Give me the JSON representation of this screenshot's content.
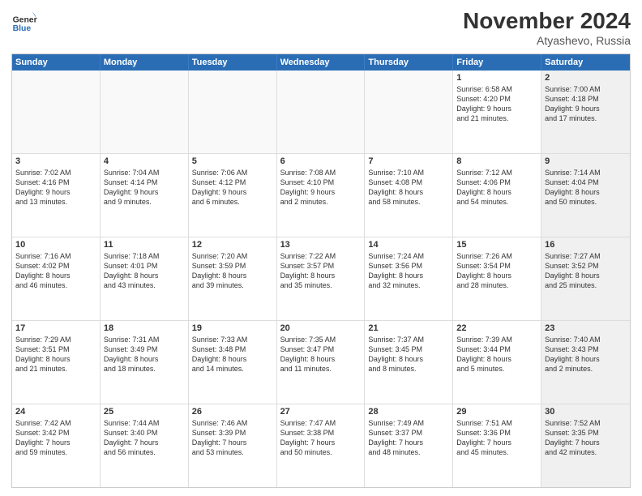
{
  "header": {
    "title": "November 2024",
    "location": "Atyashevo, Russia"
  },
  "days": [
    "Sunday",
    "Monday",
    "Tuesday",
    "Wednesday",
    "Thursday",
    "Friday",
    "Saturday"
  ],
  "rows": [
    [
      {
        "day": "",
        "info": "",
        "empty": true
      },
      {
        "day": "",
        "info": "",
        "empty": true
      },
      {
        "day": "",
        "info": "",
        "empty": true
      },
      {
        "day": "",
        "info": "",
        "empty": true
      },
      {
        "day": "",
        "info": "",
        "empty": true
      },
      {
        "day": "1",
        "info": "Sunrise: 6:58 AM\nSunset: 4:20 PM\nDaylight: 9 hours\nand 21 minutes.",
        "empty": false
      },
      {
        "day": "2",
        "info": "Sunrise: 7:00 AM\nSunset: 4:18 PM\nDaylight: 9 hours\nand 17 minutes.",
        "empty": false,
        "shaded": true
      }
    ],
    [
      {
        "day": "3",
        "info": "Sunrise: 7:02 AM\nSunset: 4:16 PM\nDaylight: 9 hours\nand 13 minutes.",
        "empty": false
      },
      {
        "day": "4",
        "info": "Sunrise: 7:04 AM\nSunset: 4:14 PM\nDaylight: 9 hours\nand 9 minutes.",
        "empty": false
      },
      {
        "day": "5",
        "info": "Sunrise: 7:06 AM\nSunset: 4:12 PM\nDaylight: 9 hours\nand 6 minutes.",
        "empty": false
      },
      {
        "day": "6",
        "info": "Sunrise: 7:08 AM\nSunset: 4:10 PM\nDaylight: 9 hours\nand 2 minutes.",
        "empty": false
      },
      {
        "day": "7",
        "info": "Sunrise: 7:10 AM\nSunset: 4:08 PM\nDaylight: 8 hours\nand 58 minutes.",
        "empty": false
      },
      {
        "day": "8",
        "info": "Sunrise: 7:12 AM\nSunset: 4:06 PM\nDaylight: 8 hours\nand 54 minutes.",
        "empty": false
      },
      {
        "day": "9",
        "info": "Sunrise: 7:14 AM\nSunset: 4:04 PM\nDaylight: 8 hours\nand 50 minutes.",
        "empty": false,
        "shaded": true
      }
    ],
    [
      {
        "day": "10",
        "info": "Sunrise: 7:16 AM\nSunset: 4:02 PM\nDaylight: 8 hours\nand 46 minutes.",
        "empty": false
      },
      {
        "day": "11",
        "info": "Sunrise: 7:18 AM\nSunset: 4:01 PM\nDaylight: 8 hours\nand 43 minutes.",
        "empty": false
      },
      {
        "day": "12",
        "info": "Sunrise: 7:20 AM\nSunset: 3:59 PM\nDaylight: 8 hours\nand 39 minutes.",
        "empty": false
      },
      {
        "day": "13",
        "info": "Sunrise: 7:22 AM\nSunset: 3:57 PM\nDaylight: 8 hours\nand 35 minutes.",
        "empty": false
      },
      {
        "day": "14",
        "info": "Sunrise: 7:24 AM\nSunset: 3:56 PM\nDaylight: 8 hours\nand 32 minutes.",
        "empty": false
      },
      {
        "day": "15",
        "info": "Sunrise: 7:26 AM\nSunset: 3:54 PM\nDaylight: 8 hours\nand 28 minutes.",
        "empty": false
      },
      {
        "day": "16",
        "info": "Sunrise: 7:27 AM\nSunset: 3:52 PM\nDaylight: 8 hours\nand 25 minutes.",
        "empty": false,
        "shaded": true
      }
    ],
    [
      {
        "day": "17",
        "info": "Sunrise: 7:29 AM\nSunset: 3:51 PM\nDaylight: 8 hours\nand 21 minutes.",
        "empty": false
      },
      {
        "day": "18",
        "info": "Sunrise: 7:31 AM\nSunset: 3:49 PM\nDaylight: 8 hours\nand 18 minutes.",
        "empty": false
      },
      {
        "day": "19",
        "info": "Sunrise: 7:33 AM\nSunset: 3:48 PM\nDaylight: 8 hours\nand 14 minutes.",
        "empty": false
      },
      {
        "day": "20",
        "info": "Sunrise: 7:35 AM\nSunset: 3:47 PM\nDaylight: 8 hours\nand 11 minutes.",
        "empty": false
      },
      {
        "day": "21",
        "info": "Sunrise: 7:37 AM\nSunset: 3:45 PM\nDaylight: 8 hours\nand 8 minutes.",
        "empty": false
      },
      {
        "day": "22",
        "info": "Sunrise: 7:39 AM\nSunset: 3:44 PM\nDaylight: 8 hours\nand 5 minutes.",
        "empty": false
      },
      {
        "day": "23",
        "info": "Sunrise: 7:40 AM\nSunset: 3:43 PM\nDaylight: 8 hours\nand 2 minutes.",
        "empty": false,
        "shaded": true
      }
    ],
    [
      {
        "day": "24",
        "info": "Sunrise: 7:42 AM\nSunset: 3:42 PM\nDaylight: 7 hours\nand 59 minutes.",
        "empty": false
      },
      {
        "day": "25",
        "info": "Sunrise: 7:44 AM\nSunset: 3:40 PM\nDaylight: 7 hours\nand 56 minutes.",
        "empty": false
      },
      {
        "day": "26",
        "info": "Sunrise: 7:46 AM\nSunset: 3:39 PM\nDaylight: 7 hours\nand 53 minutes.",
        "empty": false
      },
      {
        "day": "27",
        "info": "Sunrise: 7:47 AM\nSunset: 3:38 PM\nDaylight: 7 hours\nand 50 minutes.",
        "empty": false
      },
      {
        "day": "28",
        "info": "Sunrise: 7:49 AM\nSunset: 3:37 PM\nDaylight: 7 hours\nand 48 minutes.",
        "empty": false
      },
      {
        "day": "29",
        "info": "Sunrise: 7:51 AM\nSunset: 3:36 PM\nDaylight: 7 hours\nand 45 minutes.",
        "empty": false
      },
      {
        "day": "30",
        "info": "Sunrise: 7:52 AM\nSunset: 3:35 PM\nDaylight: 7 hours\nand 42 minutes.",
        "empty": false,
        "shaded": true
      }
    ]
  ]
}
